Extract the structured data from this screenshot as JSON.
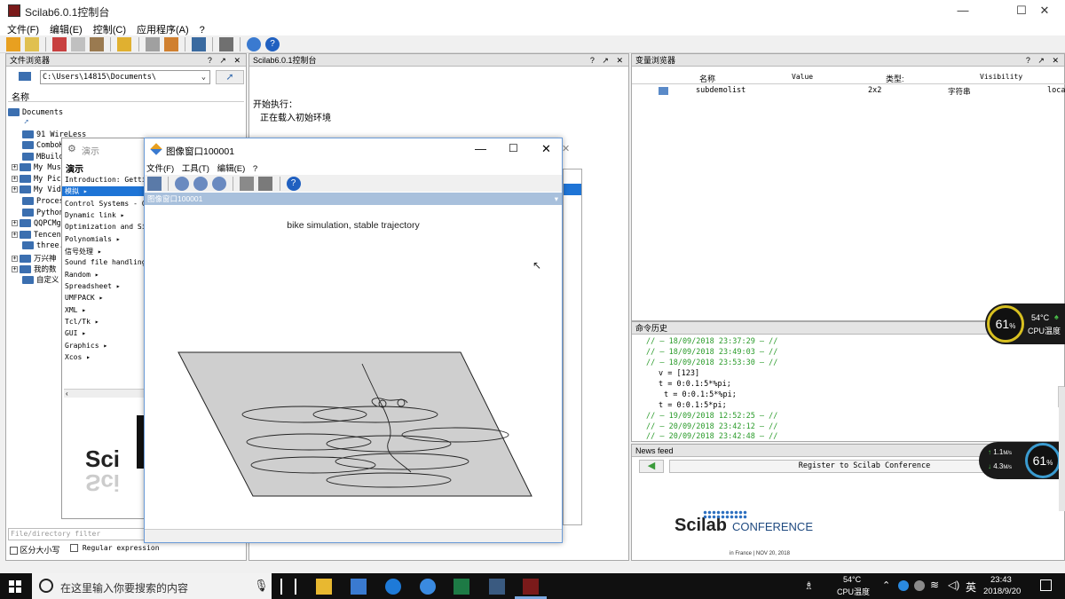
{
  "window": {
    "title": "Scilab6.0.1控制台"
  },
  "menu": [
    "文件(F)",
    "编辑(E)",
    "控制(C)",
    "应用程序(A)",
    "?"
  ],
  "file_browser": {
    "title": "文件浏览器",
    "path": "C:\\Users\\14815\\Documents\\",
    "column": "名称",
    "root": "Documents",
    "items": [
      "91 WireLess",
      "ComboK",
      "MBuild",
      "My Mus",
      "My Pic",
      "My Vid",
      "Proces",
      "Python",
      "QQPCMg",
      "Tencen",
      "three.",
      "万兴神",
      "我的数",
      "自定义"
    ],
    "filter_placeholder": "File/directory filter",
    "case_label": "区分大小写",
    "regex_label": "Regular expression"
  },
  "console": {
    "title": "Scilab6.0.1控制台",
    "lines": [
      "开始执行：",
      "正在载入初始环境"
    ]
  },
  "variable_browser": {
    "title": "变量浏览器",
    "columns": [
      "名称",
      "Value",
      "类型:",
      "Visibility"
    ],
    "rows": [
      {
        "name": "subdemolist",
        "value": "2x2",
        "type": "字符串",
        "visibility": "local"
      }
    ]
  },
  "history": {
    "title": "命令历史",
    "lines": [
      "// — 18/09/2018 23:37:29 — //",
      "// — 18/09/2018 23:49:03 — //",
      "// — 18/09/2018 23:53:30 — //",
      "v = [123]",
      "t = 0:0.1:5*%pi;",
      "t = 0:0.1:5*%pi;",
      "t = 0:0.1:5*pi;",
      "// — 19/09/2018 12:52:25 — //",
      "// — 20/09/2018 23:42:12 — //",
      "// — 20/09/2018 23:42:48 — //"
    ]
  },
  "news": {
    "title": "News feed",
    "button": "Register to Scilab Conference",
    "logo_scilab": "Scilab",
    "logo_conf": "CONFERENCE",
    "logo_sub": "in France | NOV 20, 2018"
  },
  "demo": {
    "title": "演示",
    "heading": "演示",
    "items": [
      "Introduction: Getti",
      "模拟 ▸",
      "Control Systems - C",
      "Dynamic link ▸",
      "Optimization and Si",
      "Polynomials ▸",
      "信号处理 ▸",
      "Sound file handling",
      "Random ▸",
      "Spreadsheet ▸",
      "UMFPACK ▸",
      "XML ▸",
      "Tcl/Tk ▸",
      "GUI ▸",
      "Graphics ▸",
      "Xcos ▸"
    ]
  },
  "figure": {
    "title": "图像窗口100001",
    "menu": [
      "文件(F)",
      "工具(T)",
      "编辑(E)",
      "?"
    ],
    "dock_title": "图像窗口100001",
    "plot_title": "bike simulation, stable trajectory"
  },
  "widgets": {
    "cpu_percent": "61",
    "percent_sign": "%",
    "cpu_temp": "54°C",
    "cpu_temp_label": "CPU温度",
    "net_up": "1.1",
    "net_down": "4.3",
    "net_unit": "M/s",
    "net_percent": "61"
  },
  "taskbar": {
    "search_placeholder": "在这里输入你要搜索的内容",
    "temp": "54°C",
    "temp_label": "CPU温度",
    "ime": "英",
    "time": "23:43",
    "date": "2018/9/20"
  },
  "colors": {
    "accent": "#3b6fb0",
    "selection": "#1e74d6",
    "history_green": "#2a9b2a"
  }
}
